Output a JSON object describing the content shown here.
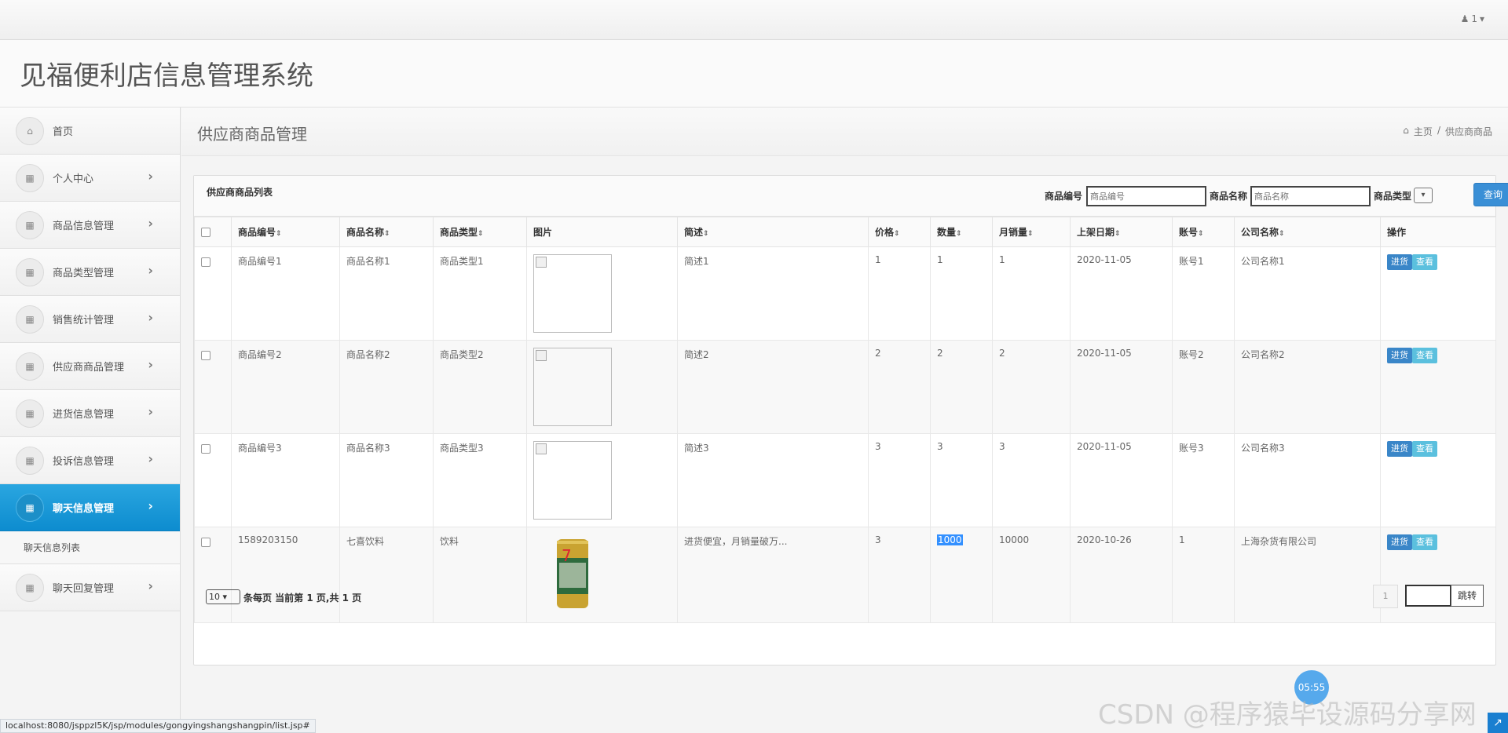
{
  "top": {
    "user": "1"
  },
  "app_title": "见福便利店信息管理系统",
  "sidebar": {
    "items": [
      {
        "label": "首页"
      },
      {
        "label": "个人中心"
      },
      {
        "label": "商品信息管理"
      },
      {
        "label": "商品类型管理"
      },
      {
        "label": "销售统计管理"
      },
      {
        "label": "供应商商品管理"
      },
      {
        "label": "进货信息管理"
      },
      {
        "label": "投诉信息管理"
      },
      {
        "label": "聊天信息管理"
      },
      {
        "label": "聊天回复管理"
      }
    ],
    "sub_item": "聊天信息列表"
  },
  "page": {
    "title": "供应商商品管理",
    "breadcrumb_home": "主页",
    "breadcrumb_sep": "/",
    "breadcrumb_current": "供应商商品"
  },
  "panel": {
    "title": "供应商商品列表",
    "search": {
      "code_label": "商品编号",
      "code_placeholder": "商品编号",
      "name_label": "商品名称",
      "name_placeholder": "商品名称",
      "type_label": "商品类型",
      "query_button": "查询"
    }
  },
  "table": {
    "headers": [
      "商品编号",
      "商品名称",
      "商品类型",
      "图片",
      "简述",
      "价格",
      "数量",
      "月销量",
      "上架日期",
      "账号",
      "公司名称",
      "操作"
    ],
    "rows": [
      [
        "商品编号1",
        "商品名称1",
        "商品类型1",
        "",
        "简述1",
        "1",
        "1",
        "1",
        "2020-11-05",
        "账号1",
        "公司名称1"
      ],
      [
        "商品编号2",
        "商品名称2",
        "商品类型2",
        "",
        "简述2",
        "2",
        "2",
        "2",
        "2020-11-05",
        "账号2",
        "公司名称2"
      ],
      [
        "商品编号3",
        "商品名称3",
        "商品类型3",
        "",
        "简述3",
        "3",
        "3",
        "3",
        "2020-11-05",
        "账号3",
        "公司名称3"
      ],
      [
        "1589203150",
        "七喜饮料",
        "饮料",
        "",
        "进货便宜，月销量破万...",
        "3",
        "1000",
        "10000",
        "2020-10-26",
        "1",
        "上海杂货有限公司"
      ]
    ],
    "action_in": "进货",
    "action_view": "查看"
  },
  "pager": {
    "per_page": "10",
    "info": "条每页 当前第 1 页,共 1 页",
    "page": "1",
    "jump": "跳转"
  },
  "status_url": "localhost:8080/jsppzl5K/jsp/modules/gongyingshangshangpin/list.jsp#",
  "timer": "05:55",
  "watermark": "CSDN @程序猿毕设源码分享网"
}
